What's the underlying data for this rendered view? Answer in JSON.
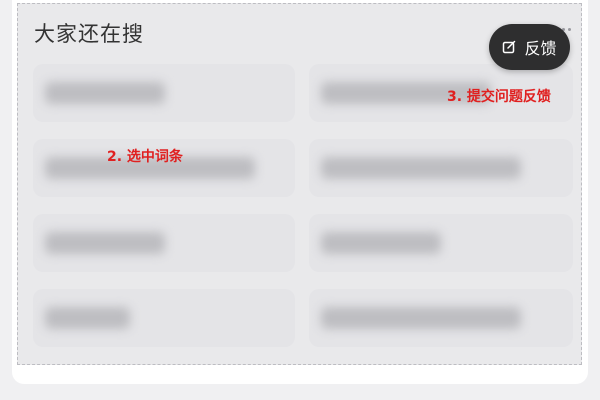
{
  "panel": {
    "title": "大家还在搜",
    "feedback_button": {
      "label": "反馈",
      "icon": "edit-icon"
    },
    "more_icon": "more-icon"
  },
  "search_items": [
    {
      "label": ""
    },
    {
      "label": ""
    },
    {
      "label": ""
    },
    {
      "label": ""
    },
    {
      "label": ""
    },
    {
      "label": ""
    },
    {
      "label": ""
    },
    {
      "label": ""
    }
  ],
  "annotations": {
    "select_item": "2. 选中词条",
    "submit_feedback": "3. 提交问题反馈"
  },
  "colors": {
    "annotation": "#e02020",
    "button_bg": "#2e2e2f"
  }
}
